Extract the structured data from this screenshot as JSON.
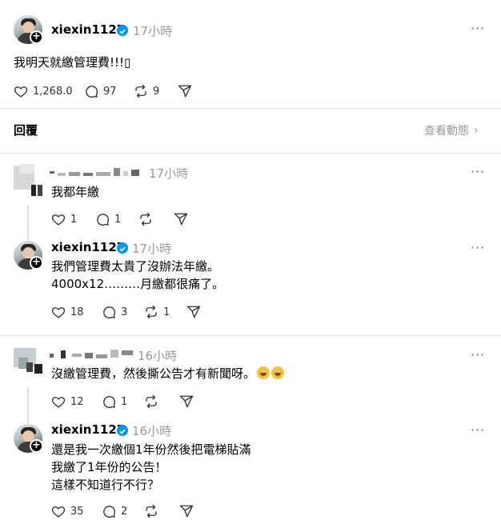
{
  "post": {
    "username": "xiexin1127",
    "time": "17小時",
    "text": "我明天就繳管理費!!!▯",
    "likes": "1,268.0",
    "comments": "97",
    "reposts": "9"
  },
  "replies_header": {
    "label": "回覆",
    "view_activity": "查看動態"
  },
  "threads": [
    {
      "comment": {
        "time": "17小時",
        "text": "我都年繳",
        "likes": "1",
        "comments": "1"
      },
      "reply": {
        "username": "xiexin1127",
        "time": "17小時",
        "line1": "我們管理費太貴了沒辦法年繳。",
        "line2": "4000x12………月繳都很痛了。",
        "likes": "18",
        "comments": "3",
        "reposts": "1"
      }
    },
    {
      "comment": {
        "time": "16小時",
        "text": "沒繳管理費，然後撕公告才有新聞呀。",
        "emoji": "rolling-on-floor-laughing",
        "likes": "12",
        "comments": "1"
      },
      "reply": {
        "username": "xiexin1127",
        "time": "16小時",
        "line1": "還是我一次繳個1年份然後把電梯貼滿",
        "line2": "我繳了1年份的公告！",
        "line3": "這樣不知道行不行？",
        "likes": "35",
        "comments": "2"
      }
    }
  ],
  "icons": {
    "heart": "heart-icon",
    "comment": "comment-icon",
    "repost": "repost-icon",
    "share": "share-icon",
    "more": "more-icon",
    "verified": "verified-icon"
  },
  "colors": {
    "verified": "#0095f6",
    "muted": "#999999",
    "divider": "#e5e5e5"
  }
}
